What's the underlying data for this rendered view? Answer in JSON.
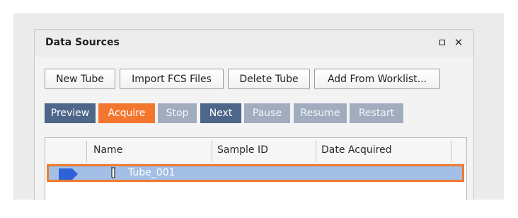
{
  "panel": {
    "title": "Data Sources"
  },
  "toolbar": {
    "new_tube": "New Tube",
    "import_fcs": "Import FCS Files",
    "delete_tube": "Delete Tube",
    "add_from_worklist": "Add From Worklist..."
  },
  "acquisition": {
    "preview": "Preview",
    "acquire": "Acquire",
    "stop": "Stop",
    "next": "Next",
    "pause": "Pause",
    "resume": "Resume",
    "restart": "Restart"
  },
  "grid": {
    "columns": [
      "Name",
      "Sample ID",
      "Date Acquired"
    ],
    "rows": [
      {
        "name": "Tube_001",
        "sample_id": "",
        "date_acquired": "",
        "selected": true
      }
    ]
  },
  "colors": {
    "accent_orange": "#f3762f",
    "button_dark": "#4d6689",
    "button_disabled": "#a1adbf",
    "row_selected": "#a3bfe5",
    "row_indicator": "#2f62d8"
  },
  "icons": [
    "maximize-icon",
    "close-icon",
    "current-row-indicator-icon",
    "tube-icon"
  ]
}
